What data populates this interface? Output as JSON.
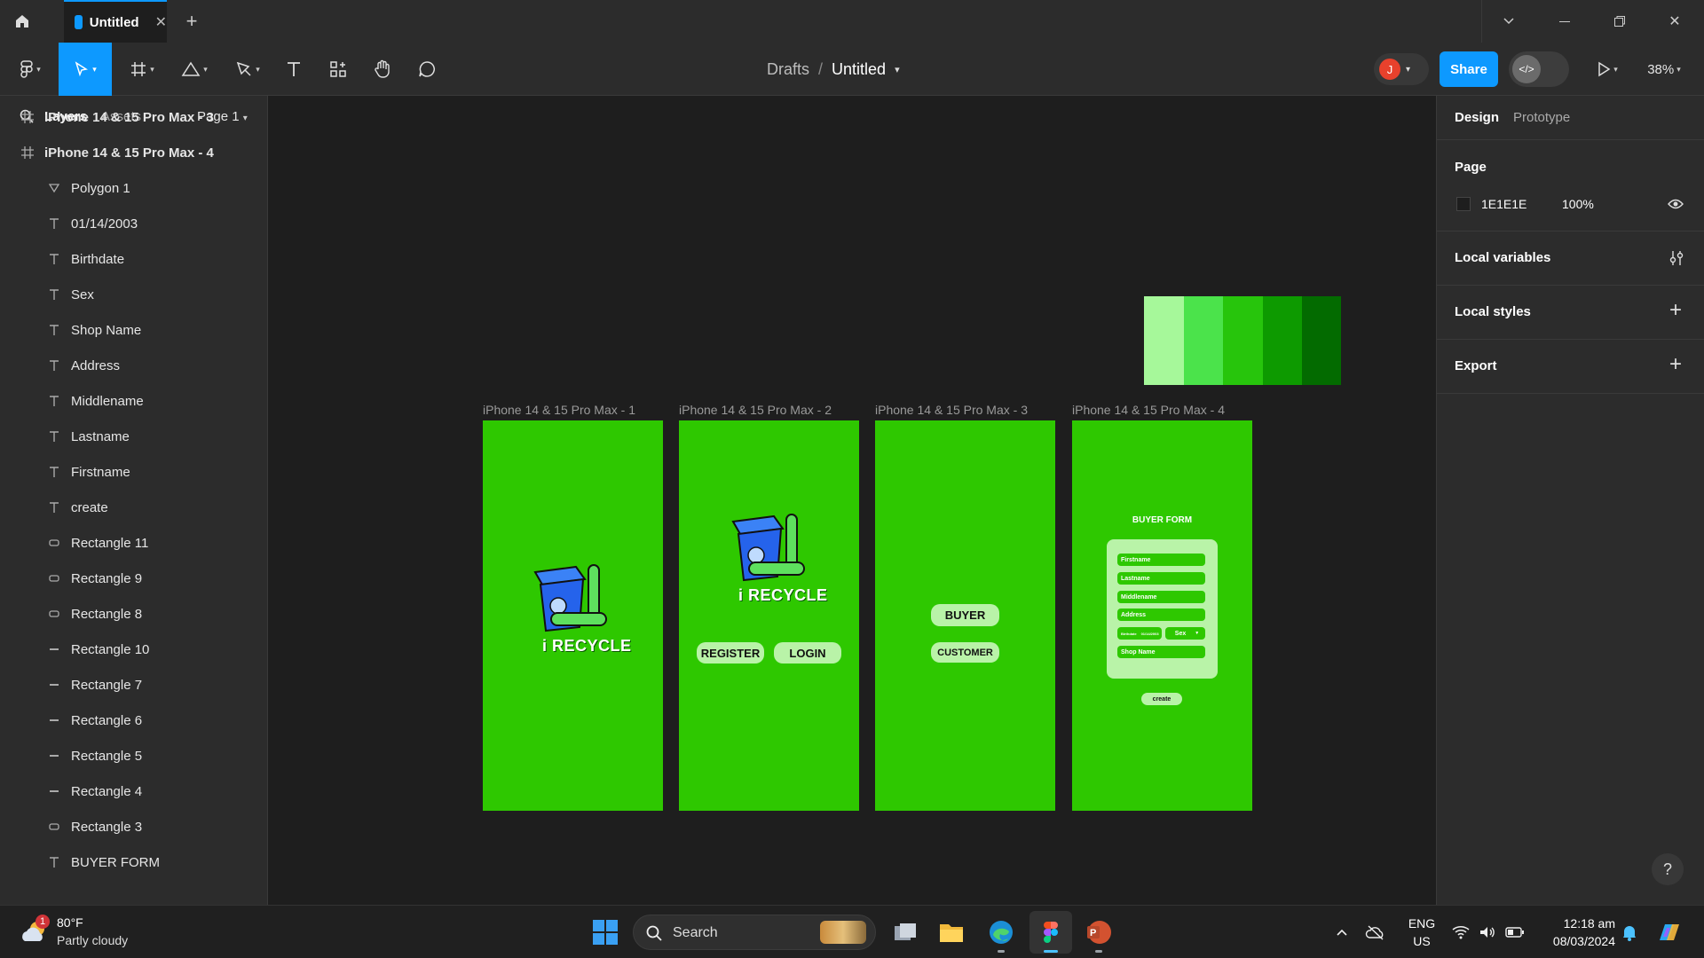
{
  "titlebar": {
    "tab_title": "Untitled",
    "icons": [
      "home-icon",
      "figma-file-icon",
      "close-icon",
      "plus-icon",
      "chevron-down-icon",
      "minimize-icon",
      "restore-icon",
      "window-close-icon"
    ]
  },
  "toolbar": {
    "breadcrumb_parent": "Drafts",
    "breadcrumb_sep": "/",
    "file_name": "Untitled",
    "avatar_initial": "J",
    "avatar_color": "#e8412c",
    "share_label": "Share",
    "zoom": "38%",
    "accent": "#0d99ff"
  },
  "left_panel": {
    "tabs": {
      "layers": "Layers",
      "assets": "Assets"
    },
    "page": "Page 1",
    "layers": [
      {
        "label": "iPhone 14 & 15 Pro Max - 3",
        "icon": "frame-icon",
        "indent": false
      },
      {
        "label": "iPhone 14 & 15 Pro Max - 4",
        "icon": "frame-icon",
        "indent": false
      },
      {
        "label": "Polygon 1",
        "icon": "polygon-icon",
        "indent": true
      },
      {
        "label": "01/14/2003",
        "icon": "text-icon",
        "indent": true
      },
      {
        "label": "Birthdate",
        "icon": "text-icon",
        "indent": true
      },
      {
        "label": "Sex",
        "icon": "text-icon",
        "indent": true
      },
      {
        "label": "Shop Name",
        "icon": "text-icon",
        "indent": true
      },
      {
        "label": "Address",
        "icon": "text-icon",
        "indent": true
      },
      {
        "label": "Middlename",
        "icon": "text-icon",
        "indent": true
      },
      {
        "label": "Lastname",
        "icon": "text-icon",
        "indent": true
      },
      {
        "label": "Firstname",
        "icon": "text-icon",
        "indent": true
      },
      {
        "label": "create",
        "icon": "text-icon",
        "indent": true
      },
      {
        "label": "Rectangle 11",
        "icon": "rectangle-icon",
        "indent": true
      },
      {
        "label": "Rectangle 9",
        "icon": "rectangle-icon",
        "indent": true
      },
      {
        "label": "Rectangle 8",
        "icon": "rectangle-icon",
        "indent": true
      },
      {
        "label": "Rectangle 10",
        "icon": "line-icon",
        "indent": true
      },
      {
        "label": "Rectangle 7",
        "icon": "line-icon",
        "indent": true
      },
      {
        "label": "Rectangle 6",
        "icon": "line-icon",
        "indent": true
      },
      {
        "label": "Rectangle 5",
        "icon": "line-icon",
        "indent": true
      },
      {
        "label": "Rectangle 4",
        "icon": "line-icon",
        "indent": true
      },
      {
        "label": "Rectangle 3",
        "icon": "rectangle-icon",
        "indent": true
      },
      {
        "label": "BUYER FORM",
        "icon": "text-icon",
        "indent": true
      }
    ]
  },
  "canvas": {
    "swatches": [
      "#a6f89a",
      "#4be34b",
      "#27c50c",
      "#0d9a00",
      "#036b00"
    ],
    "frames": [
      {
        "label": "iPhone 14 & 15 Pro Max - 1"
      },
      {
        "label": "iPhone 14 & 15 Pro Max - 2"
      },
      {
        "label": "iPhone 14 & 15 Pro Max - 3"
      },
      {
        "label": "iPhone 14 & 15 Pro Max - 4"
      }
    ],
    "frame_color": "#2ec800",
    "logo_text": "i RECYCLE",
    "register_label": "REGISTER",
    "login_label": "LOGIN",
    "buyer_label": "BUYER",
    "customer_label": "CUSTOMER",
    "form": {
      "title": "BUYER FORM",
      "fields": [
        "Firstname",
        "Lastname",
        "Middlename",
        "Address"
      ],
      "birthdate_label": "Birthdate",
      "birthdate_value": "01/14/2003",
      "sex_label": "Sex",
      "shop_label": "Shop Name",
      "create_label": "create"
    }
  },
  "right_panel": {
    "tabs": {
      "design": "Design",
      "prototype": "Prototype"
    },
    "page_title": "Page",
    "page_color_hex": "1E1E1E",
    "page_opacity": "100%",
    "local_variables": "Local variables",
    "local_styles": "Local styles",
    "export": "Export",
    "help": "?"
  },
  "taskbar": {
    "temperature": "80°F",
    "weather": "Partly cloudy",
    "weather_badge": "1",
    "search_label": "Search",
    "lang": "ENG",
    "region": "US",
    "time": "12:18 am",
    "date": "08/03/2024"
  }
}
